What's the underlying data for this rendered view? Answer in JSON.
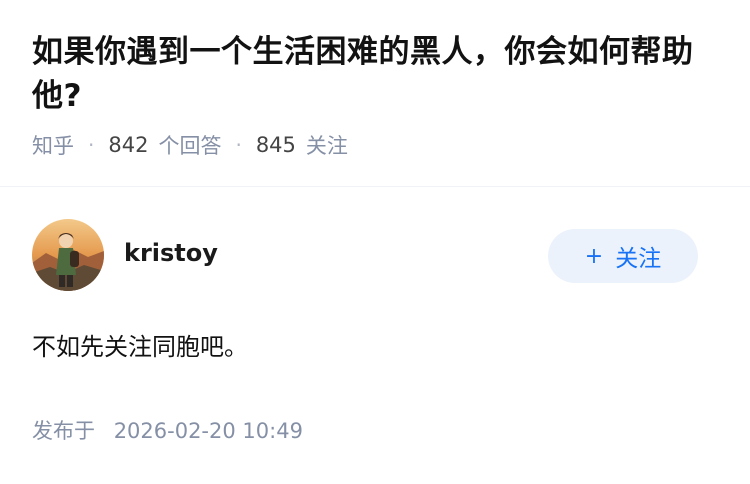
{
  "question": {
    "title": "如果你遇到一个生活困难的黑人，你会如何帮助他?",
    "source": "知乎",
    "answer_count": "842",
    "answer_label": "个回答",
    "follower_count": "845",
    "follower_label": "关注"
  },
  "answer": {
    "author": {
      "name": "kristoy",
      "avatar_icon": "avatar-image"
    },
    "follow_button": {
      "icon": "plus-icon",
      "plus": "+",
      "label": "关注"
    },
    "content": "不如先关注同胞吧。",
    "published_label": "发布于",
    "published_time": "2026-02-20 10:49"
  },
  "colors": {
    "muted": "#8590a6",
    "accent": "#1772f6",
    "button_bg": "#ebf2fb"
  }
}
